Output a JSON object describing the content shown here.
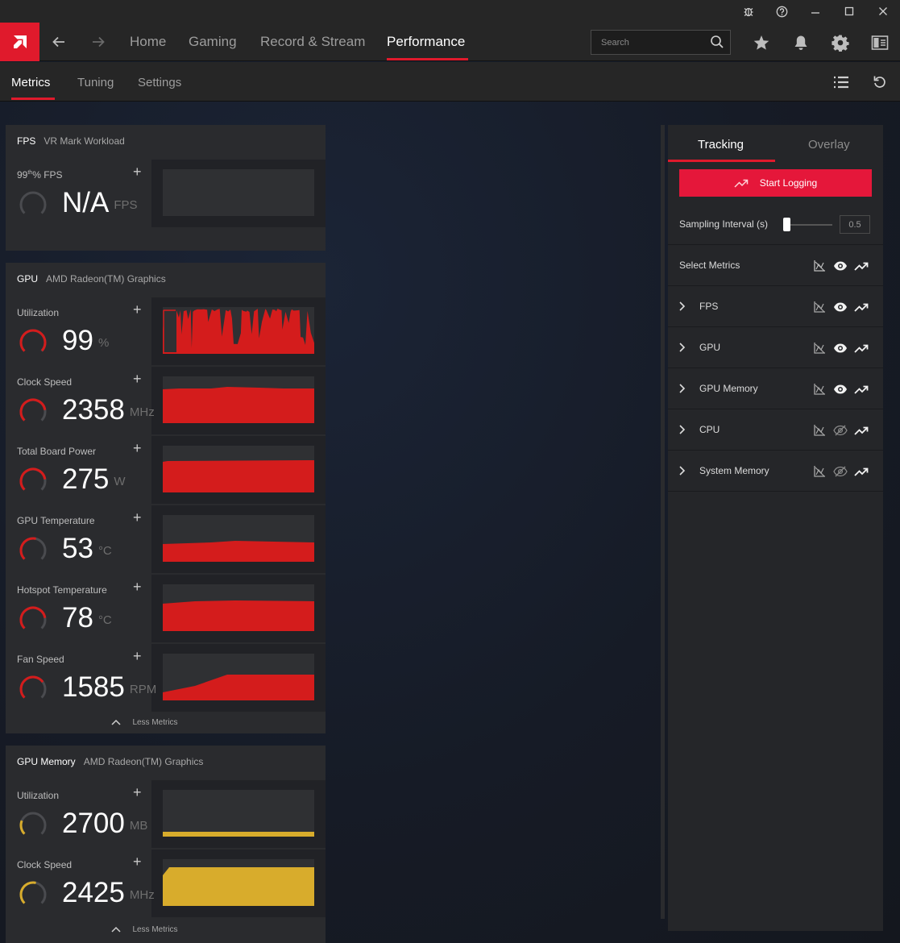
{
  "nav": {
    "items": [
      "Home",
      "Gaming",
      "Record & Stream",
      "Performance"
    ],
    "search_placeholder": "Search"
  },
  "subtabs": [
    "Metrics",
    "Tuning",
    "Settings"
  ],
  "fps_panel": {
    "title": "FPS",
    "subtitle": "VR Mark Workload",
    "metric": {
      "label_prefix": "99",
      "label_sup": "th",
      "label_suffix": "% FPS",
      "value": "N/A",
      "unit": "FPS"
    }
  },
  "gpu_panel": {
    "title": "GPU",
    "subtitle": "AMD Radeon(TM) Graphics",
    "metrics": [
      {
        "label": "Utilization",
        "value": "99",
        "unit": "%",
        "gauge": 0.99
      },
      {
        "label": "Clock Speed",
        "value": "2358",
        "unit": "MHz",
        "gauge": 0.8
      },
      {
        "label": "Total Board Power",
        "value": "275",
        "unit": "W",
        "gauge": 0.8
      },
      {
        "label": "GPU Temperature",
        "value": "53",
        "unit": "°C",
        "gauge": 0.55
      },
      {
        "label": "Hotspot Temperature",
        "value": "78",
        "unit": "°C",
        "gauge": 0.8
      },
      {
        "label": "Fan Speed",
        "value": "1585",
        "unit": "RPM",
        "gauge": 0.7
      }
    ],
    "less_metrics": "Less Metrics"
  },
  "gpu_memory_panel": {
    "title": "GPU Memory",
    "subtitle": "AMD Radeon(TM) Graphics",
    "metrics": [
      {
        "label": "Utilization",
        "value": "2700",
        "unit": "MB",
        "gauge": 0.25
      },
      {
        "label": "Clock Speed",
        "value": "2425",
        "unit": "MHz",
        "gauge": 0.55
      }
    ],
    "less_metrics": "Less Metrics"
  },
  "right_panel": {
    "tabs": [
      "Tracking",
      "Overlay"
    ],
    "start_logging": "Start Logging",
    "sampling_label": "Sampling Interval (s)",
    "sampling_value": "0.5",
    "select_metrics": "Select Metrics",
    "groups": [
      {
        "label": "FPS",
        "visible": true
      },
      {
        "label": "GPU",
        "visible": true
      },
      {
        "label": "GPU Memory",
        "visible": true
      },
      {
        "label": "CPU",
        "visible": false
      },
      {
        "label": "System Memory",
        "visible": false
      }
    ]
  },
  "colors": {
    "accent": "#e01a2c",
    "gpu_graph": "#d41c1c",
    "memory_graph": "#d8ac2c",
    "inactive_ring": "#4a4b4f"
  }
}
